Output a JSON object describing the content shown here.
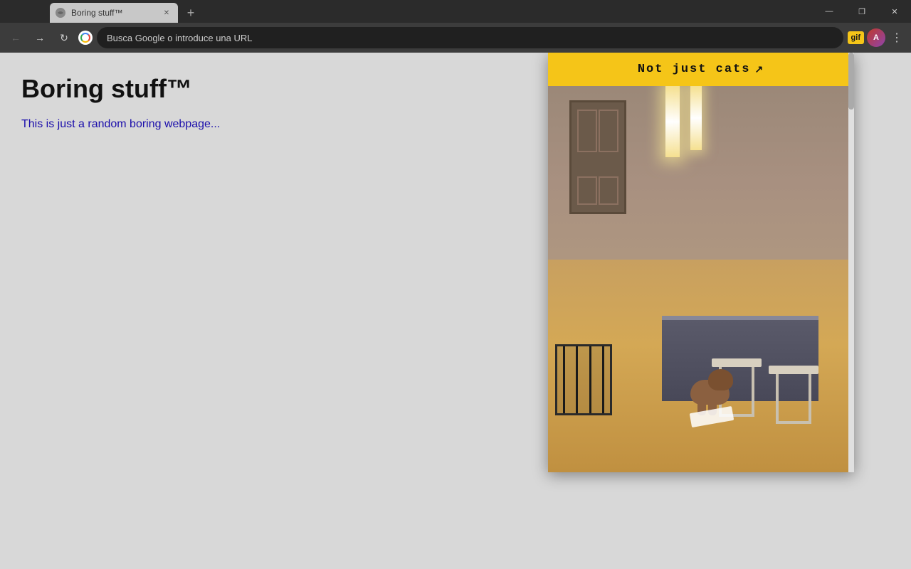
{
  "titlebar": {
    "tab_title": "Boring stuff™",
    "tab_favicon_alt": "webpage-icon",
    "new_tab_icon": "+",
    "window_controls": {
      "minimize": "—",
      "maximize": "❐",
      "close": "✕"
    }
  },
  "addressbar": {
    "back_icon": "←",
    "forward_icon": "→",
    "refresh_icon": "↻",
    "url_placeholder": "Busca Google o introduce una URL",
    "gif_btn_label": "gif",
    "menu_icon": "⋮"
  },
  "page": {
    "title": "Boring stuff™",
    "subtitle": "This is just a random boring webpage..."
  },
  "popup": {
    "header_btn_label": "Not just cats",
    "external_link_icon": "↗"
  }
}
